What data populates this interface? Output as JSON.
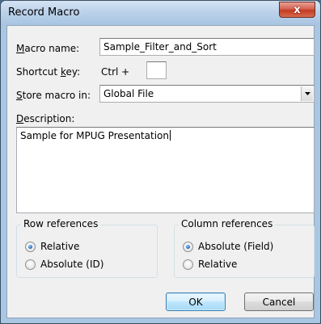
{
  "window": {
    "title": "Record Macro",
    "close_glyph": "x"
  },
  "form": {
    "macro_name": {
      "label_accel": "M",
      "label_rest": "acro name:",
      "value": "Sample_Filter_and_Sort"
    },
    "shortcut_key": {
      "label_pre": "Shortcut ",
      "label_accel": "k",
      "label_post": "ey:",
      "prefix": "Ctrl  +",
      "value": ""
    },
    "store_macro_in": {
      "label_accel": "S",
      "label_rest": "tore macro in:",
      "value": "Global File"
    },
    "description": {
      "label_accel": "D",
      "label_rest": "escription:",
      "value": "Sample for MPUG Presentation"
    }
  },
  "row_references": {
    "title": "Row references",
    "options": [
      {
        "accel": "R",
        "rest": "elative",
        "checked": true
      },
      {
        "accel": "A",
        "rest": "bsolute (ID)",
        "checked": false
      }
    ]
  },
  "column_references": {
    "title": "Column references",
    "options": [
      {
        "pre": "A",
        "accel": "b",
        "rest": "solute (Field)",
        "checked": true
      },
      {
        "pre": "Rel",
        "accel": "a",
        "rest": "tive",
        "checked": false
      }
    ]
  },
  "buttons": {
    "ok": "OK",
    "cancel": "Cancel"
  },
  "icons": {
    "close": "close-icon",
    "dropdown": "chevron-down-icon"
  }
}
